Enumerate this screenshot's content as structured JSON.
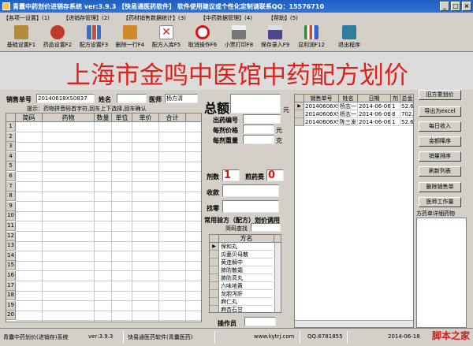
{
  "window": {
    "title": "青囊中药划价进销存系统   ver:3.9.3  【快易通医药软件】        软件使用建议或个性化定制请联系QQ：15576710",
    "controls": [
      "_",
      "□",
      "×"
    ]
  },
  "menu": [
    "【各项一设置】(1)",
    "【进销存管理】(2)",
    "【药材销售数据统计】(3)",
    "【中药数据管理】(4)",
    "【帮助】(5)"
  ],
  "toolbar": [
    {
      "label": "基础设置F1",
      "icon": "settings-icon",
      "color": "#b58b3c"
    },
    {
      "label": "药品设置F2",
      "icon": "herb-icon",
      "color": "#c0392b"
    },
    {
      "label": "配方设置F3",
      "icon": "prescription-icon",
      "color": "#3b6fc4"
    },
    {
      "label": "删除一行F4",
      "icon": "delete-row-icon",
      "color": "#d08a2a"
    },
    {
      "label": "配方入库F5",
      "icon": "store-icon",
      "color": "#cc2222"
    },
    {
      "label": "取消操作F6",
      "icon": "cancel-icon",
      "color": "#dd1111"
    },
    {
      "label": "小票打印F8",
      "icon": "print-icon",
      "color": "#555555"
    },
    {
      "label": "保存录入F9",
      "icon": "save-icon",
      "color": "#4a4a8a"
    },
    {
      "label": "显利润F12",
      "icon": "profit-chart-icon",
      "color": "#2d8a3c"
    },
    {
      "label": "退出程序",
      "icon": "exit-icon",
      "color": "#2e7d9e"
    }
  ],
  "banner": "上海市金鸣中医馆中药配方划价",
  "sale": {
    "no_label": "销售单号",
    "no_value": "20140618XS0837",
    "name_label": "姓名",
    "doctor_label": "医师",
    "doctor_value": "杨方清",
    "hint": "提示：药物拼音码首字符,回车上下选择,回车确认"
  },
  "grid": {
    "headers": [
      "简码",
      "药物",
      "数量",
      "单位",
      "单价",
      "合计"
    ],
    "rows": [
      "1",
      "2",
      "3",
      "4",
      "5",
      "6",
      "7",
      "8",
      "9",
      "10",
      "11",
      "12",
      "13",
      "14",
      "15",
      "16",
      "17",
      "18",
      "19",
      "20"
    ]
  },
  "middle": {
    "total_label": "总额",
    "yuan": "元",
    "out_no_label": "出药编号",
    "price_each_label": "每剂价格",
    "price_each_unit": "元",
    "weight_each_label": "每剂重量",
    "weight_each_unit": "克",
    "doses_label": "剂数",
    "doses_value": "1",
    "decoct_label": "煎药费",
    "decoct_value": "0",
    "received_label": "收款",
    "change_label": "找零",
    "common_title": "常用验方（配方）划价调用",
    "pinyin_label": "简码查找",
    "operator_label": "操作员"
  },
  "formula_list": {
    "header": "方名",
    "items": [
      "保和丸",
      "瓜蒌贝母散",
      "黄连解中",
      "肺防散霜",
      "肺防高丸",
      "六味地黄",
      "龙胆泻肝",
      "麻仁丸",
      "麻杏石甘"
    ]
  },
  "records": {
    "headers": [
      "销售单号",
      "姓名",
      "日期",
      "剂",
      "总金"
    ],
    "rows": [
      {
        "no": "20140606XS1",
        "name": "杨志一",
        "date": "2014-06-06",
        "dose": "1",
        "amount": "52.6"
      },
      {
        "no": "20140606XS1",
        "name": "杨志一",
        "date": "2014-06-06",
        "dose": "8",
        "amount": "702."
      },
      {
        "no": "20140606XS1",
        "name": "陈三发",
        "date": "2014-06-06",
        "dose": "1",
        "amount": "52.6"
      }
    ]
  },
  "right_buttons": [
    "旧方重划价",
    "导出为excel",
    "每日收入",
    "金额降序",
    "销量排序",
    "刷新列表",
    "删除销售单",
    "医师工作量"
  ],
  "right_section_title": "方药单详细药物",
  "status": {
    "app": "青囊中药划价(进销存)系统",
    "version": "ver:3.9.3",
    "vendor": "快易通医药软件(青囊医药)",
    "site": "www.kytrj.com",
    "qq": "QQ:8781855",
    "date": "2014-06-18",
    "watermark": "脚本之家"
  }
}
